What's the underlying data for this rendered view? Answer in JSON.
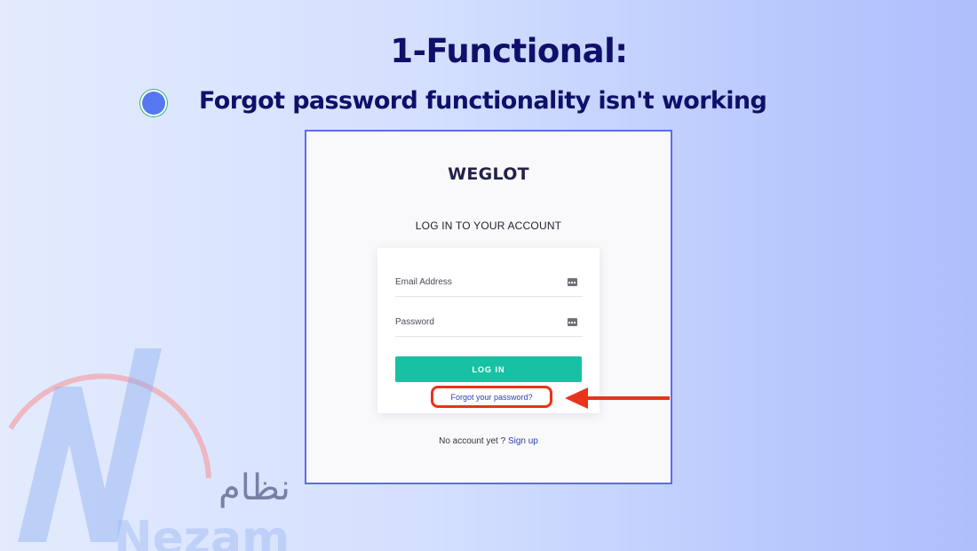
{
  "slide": {
    "title": "1-Functional:",
    "bullet": "Forgot password functionality isn't working"
  },
  "login_screenshot": {
    "brand": "WEGLOT",
    "heading": "LOG IN TO YOUR ACCOUNT",
    "email_placeholder": "Email Address",
    "password_placeholder": "Password",
    "login_button": "LOG IN",
    "forgot_link": "Forgot your password?",
    "signup_prompt": "No account yet ? ",
    "signup_link": "Sign up"
  },
  "watermark": {
    "arabic_text": "نظام",
    "latin_text": "Nezam"
  },
  "colors": {
    "title_text": "#10106a",
    "bullet_dot": "#5577f0",
    "frame_border": "#5b6cf0",
    "login_button": "#19c1a4",
    "link": "#2a3fb2",
    "highlight": "#e8341a"
  },
  "icons": {
    "bullet": "bullet-dot",
    "field_autofill": "password-manager-key-icon",
    "annotation": "red-arrow-left"
  }
}
